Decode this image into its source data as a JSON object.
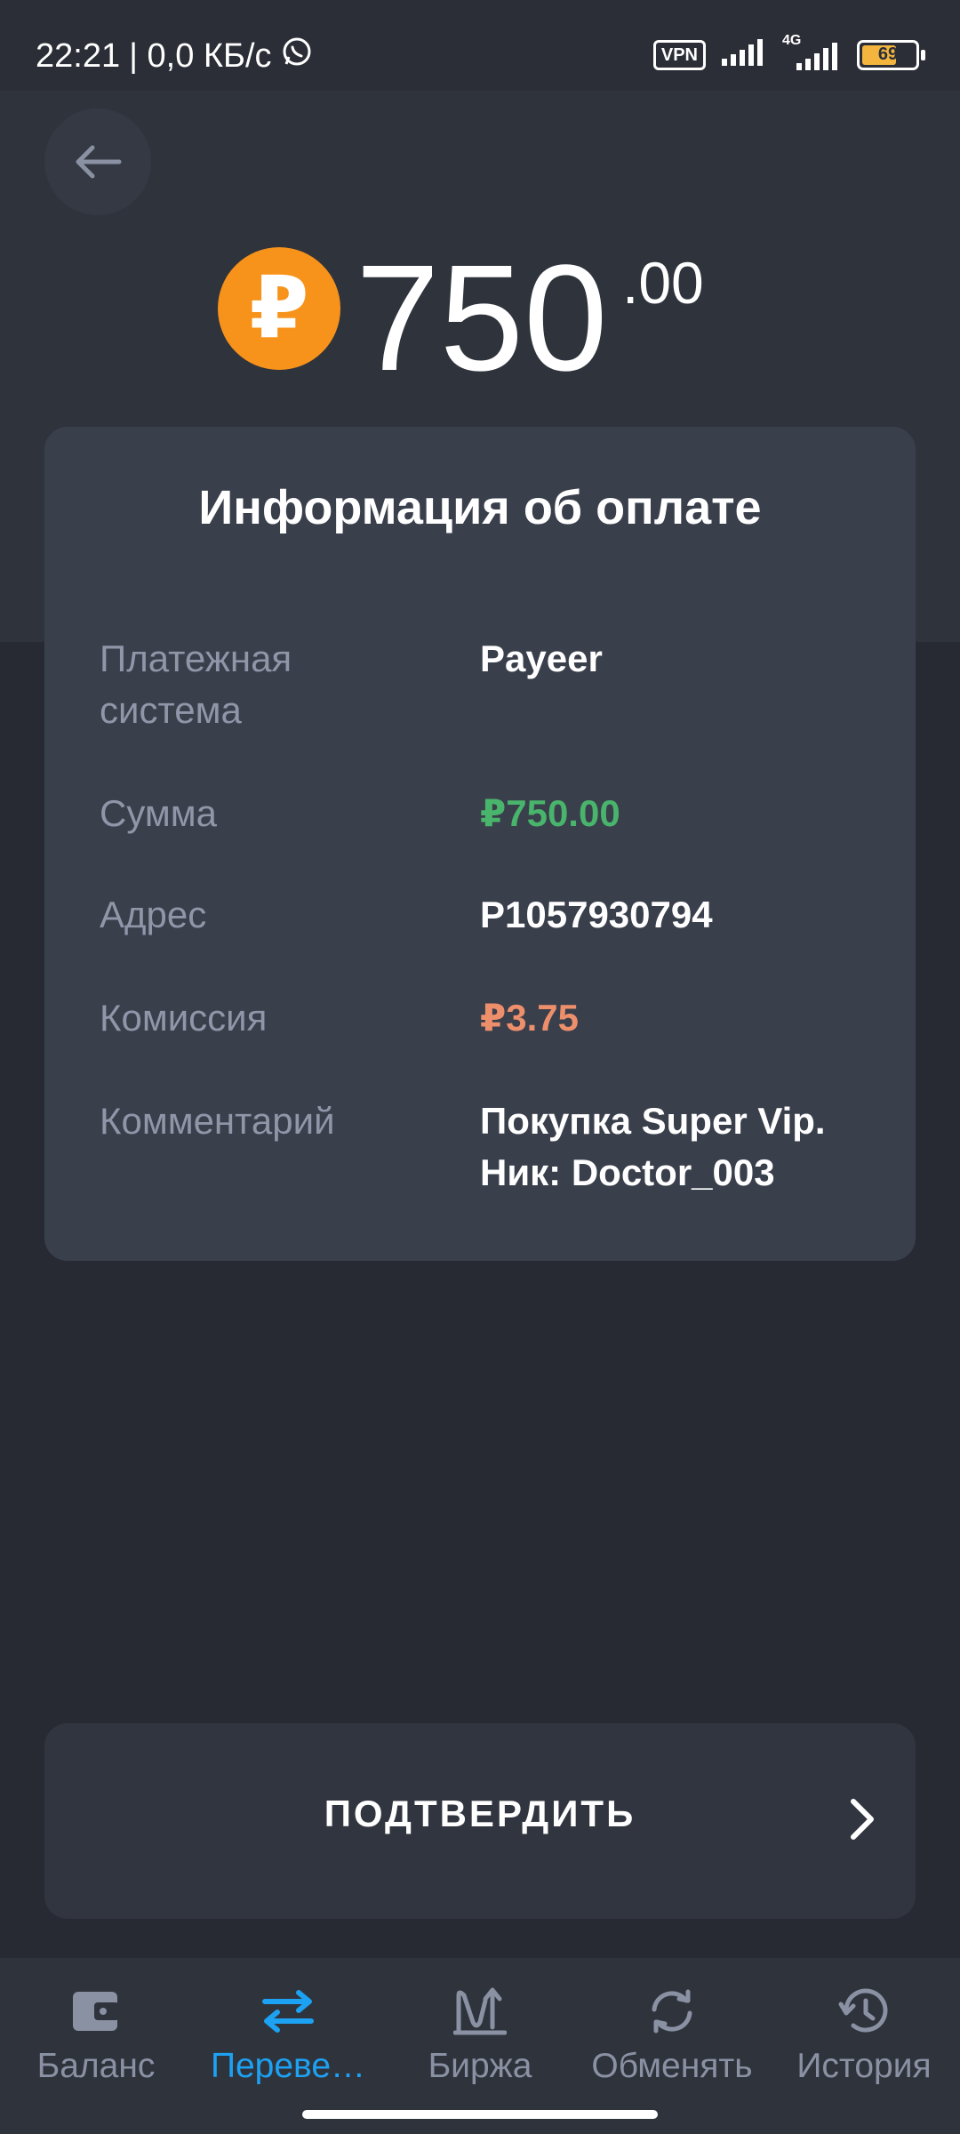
{
  "status_bar": {
    "time": "22:21",
    "net_speed": "| 0,0 КБ/с",
    "vpn_label": "VPN",
    "network_label": "4G",
    "battery_level": "69"
  },
  "amount": {
    "currency_symbol": "₽",
    "whole": "750",
    "cents": ".00"
  },
  "payment_info": {
    "title": "Информация об оплате",
    "rows": [
      {
        "label": "Платежная система",
        "value": "Payeer"
      },
      {
        "label": "Сумма",
        "value": "₽750.00"
      },
      {
        "label": "Адрес",
        "value": "P1057930794"
      },
      {
        "label": "Комиссия",
        "value": "₽3.75"
      },
      {
        "label": "Комментарий",
        "value": "Покупка Super Vip. Ник: Doctor_003"
      }
    ]
  },
  "confirm": {
    "label": "ПОДТВЕРДИТЬ"
  },
  "bottom_nav": {
    "items": [
      {
        "label": "Баланс",
        "icon": "wallet-icon"
      },
      {
        "label": "Переве…",
        "icon": "transfer-icon",
        "active": true
      },
      {
        "label": "Биржа",
        "icon": "exchange-chart-icon"
      },
      {
        "label": "Обменять",
        "icon": "swap-icon"
      },
      {
        "label": "История",
        "icon": "history-icon"
      }
    ]
  },
  "colors": {
    "background": "#272a33",
    "card": "#3a3f4c",
    "accent_blue": "#1da1f2",
    "amount_green": "#49b46b",
    "fee_red": "#ee8f6c",
    "coin_orange": "#f7931a"
  }
}
